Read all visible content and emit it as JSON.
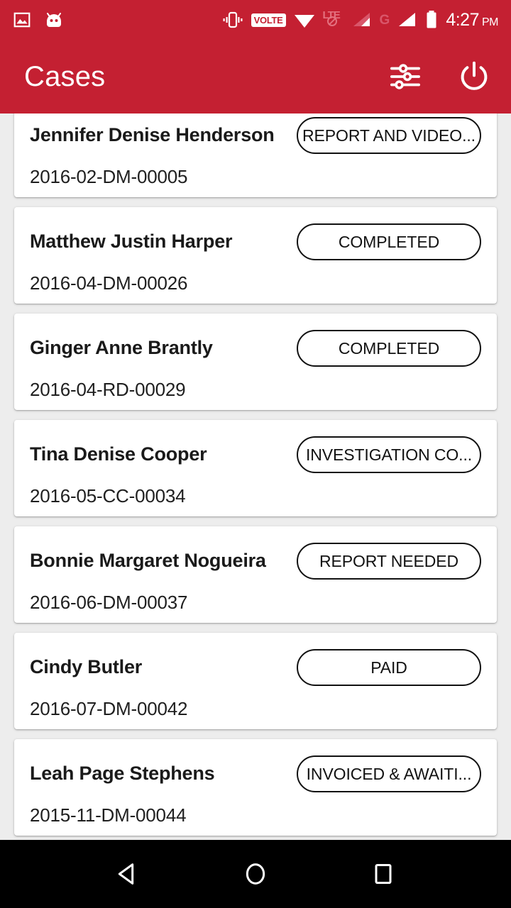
{
  "status_bar": {
    "icons": [
      {
        "name": "screenshot-icon"
      },
      {
        "name": "android-head-icon"
      },
      {
        "name": "vibrate-icon"
      },
      {
        "name": "volte-icon"
      },
      {
        "name": "wifi-icon"
      },
      {
        "name": "lte-disabled-icon"
      },
      {
        "name": "signal-bars-1-icon"
      },
      {
        "name": "gprs-icon"
      },
      {
        "name": "signal-bars-2-icon"
      },
      {
        "name": "battery-icon"
      }
    ],
    "volte_label": "VOLTE",
    "lte_label": "LTE",
    "gprs_label": "G",
    "time": "4:27",
    "time_period": "PM"
  },
  "app_bar": {
    "title": "Cases",
    "filter_icon_name": "filter-sliders-icon",
    "power_icon_name": "power-logout-icon"
  },
  "cases": [
    {
      "name": "Jennifer Denise Henderson",
      "number": "2016-02-DM-00005",
      "status": "REPORT AND VIDEO..."
    },
    {
      "name": "Matthew Justin Harper",
      "number": "2016-04-DM-00026",
      "status": "COMPLETED"
    },
    {
      "name": "Ginger Anne Brantly",
      "number": "2016-04-RD-00029",
      "status": "COMPLETED"
    },
    {
      "name": "Tina Denise Cooper",
      "number": "2016-05-CC-00034",
      "status": "INVESTIGATION CO..."
    },
    {
      "name": "Bonnie Margaret Nogueira",
      "number": "2016-06-DM-00037",
      "status": "REPORT NEEDED"
    },
    {
      "name": "Cindy Butler",
      "number": "2016-07-DM-00042",
      "status": "PAID"
    },
    {
      "name": "Leah Page Stephens",
      "number": "2015-11-DM-00044",
      "status": "INVOICED & AWAITI..."
    }
  ],
  "nav_bar": {
    "back_label": "back-icon",
    "home_label": "home-icon",
    "recents_label": "recents-icon"
  },
  "colors": {
    "brand_red": "#C42032",
    "list_background": "#EDEDED",
    "card_background": "#FFFFFF",
    "text_primary": "#1A1A1A",
    "nav_background": "#000000"
  }
}
